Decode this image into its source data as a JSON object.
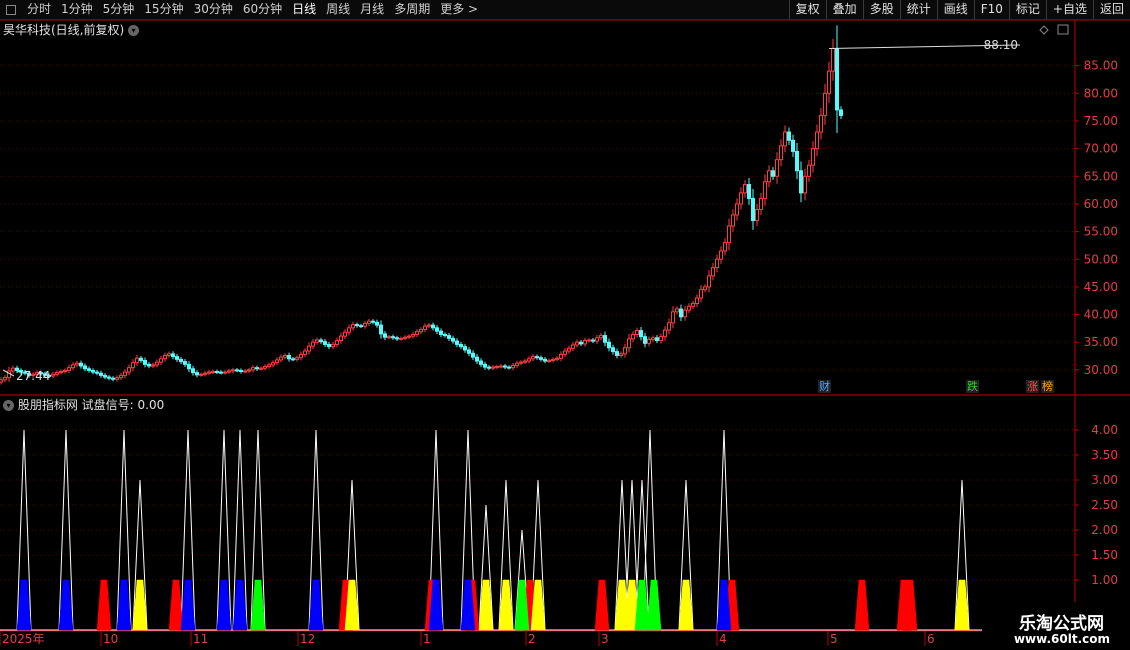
{
  "toolbar": {
    "tabs": [
      "分时",
      "1分钟",
      "5分钟",
      "15分钟",
      "30分钟",
      "60分钟",
      "日线",
      "周线",
      "月线",
      "多周期",
      "更多 >"
    ],
    "active_tab": "日线",
    "buttons": [
      "复权",
      "叠加",
      "多股",
      "统计",
      "画线",
      "F10",
      "标记",
      "+自选",
      "返回"
    ]
  },
  "stock": {
    "title": "昊华科技(日线,前复权)"
  },
  "price_panel": {
    "high_label": "88.10",
    "low_label": "27.44",
    "y_ticks": [
      "85.00",
      "80.00",
      "75.00",
      "70.00",
      "65.00",
      "60.00",
      "55.00",
      "50.00",
      "45.00",
      "40.00",
      "35.00",
      "30.00"
    ],
    "tags": [
      {
        "text": "财",
        "color": "#4ea2ff"
      },
      {
        "text": "跌",
        "color": "#33cc33"
      },
      {
        "text": "涨",
        "color": "#ff4d4d"
      },
      {
        "text": "榜",
        "color": "#ffaa00"
      }
    ]
  },
  "indicator": {
    "title": "股朋指标网 试盘信号: 0.00",
    "y_ticks": [
      "4.00",
      "3.50",
      "3.00",
      "2.50",
      "2.00",
      "1.50",
      "1.00"
    ]
  },
  "x_axis": {
    "labels": [
      "2025年",
      "10",
      "11",
      "12",
      "1",
      "2",
      "3",
      "4",
      "5",
      "6"
    ]
  },
  "colors": {
    "up": "#ff3c3c",
    "down": "#54fcfc",
    "grid": "#5a0000",
    "axis": "#c00000",
    "signal_red": "#ff0000",
    "signal_blue": "#0000ff",
    "signal_yellow": "#ffff00",
    "signal_green": "#00ff00",
    "spike": "#ffffff"
  },
  "chart_data": [
    {
      "type": "candlestick",
      "title": "",
      "ylim": [
        26,
        90
      ],
      "note_scale": "linear",
      "x": [
        1,
        5,
        9,
        13,
        17,
        21,
        25,
        29,
        33,
        37,
        41,
        45,
        49,
        53,
        57,
        61,
        65,
        69,
        73,
        77,
        81,
        85,
        89,
        93,
        97,
        101,
        105,
        109,
        113,
        117,
        121,
        125,
        129,
        133,
        137,
        141,
        145,
        149,
        153,
        157,
        161,
        165,
        169,
        173,
        177,
        181,
        185,
        189,
        193,
        197,
        201,
        205,
        209,
        213,
        217,
        221,
        225,
        229,
        233,
        237,
        241,
        245,
        249,
        253,
        257,
        261,
        265,
        269,
        273,
        277,
        281,
        285,
        289,
        293,
        297,
        301,
        305,
        309,
        313,
        317,
        321,
        325,
        329,
        333,
        337,
        341,
        345,
        349,
        353,
        357,
        361,
        365,
        369,
        373,
        377,
        381,
        385,
        389,
        393,
        397,
        401,
        405,
        409,
        413,
        417,
        421,
        425,
        429,
        433,
        437,
        441,
        445,
        449,
        453,
        457,
        461,
        465,
        469,
        473,
        477,
        481,
        485,
        489,
        493,
        497,
        501,
        505,
        509,
        513,
        517,
        521,
        525,
        529,
        533,
        537,
        541,
        545,
        549,
        553,
        557,
        561,
        565,
        569,
        573,
        577,
        581,
        585,
        589,
        593,
        597,
        601,
        605,
        609,
        613,
        617,
        621,
        625,
        629,
        633,
        637,
        641,
        645,
        649,
        653,
        657,
        661,
        665,
        669,
        673,
        677,
        681,
        685,
        689,
        693,
        697,
        701,
        705,
        709,
        713,
        717,
        721,
        725,
        729,
        733,
        737,
        741,
        745,
        749,
        753,
        757,
        761,
        765,
        769,
        773,
        777,
        781,
        785,
        789,
        793,
        797,
        801,
        805,
        809,
        813,
        817,
        821,
        825,
        829,
        833,
        837,
        841,
        845,
        849,
        853,
        857,
        861,
        865,
        869,
        873,
        877,
        881,
        885,
        889,
        893,
        897,
        901,
        905,
        909,
        913,
        917,
        921,
        925,
        929,
        933,
        937,
        941,
        945,
        949,
        953,
        957,
        961,
        965,
        969,
        973,
        977,
        981,
        985,
        989,
        993,
        997,
        1001,
        1005,
        1009,
        1013,
        1017,
        1021,
        1025,
        1029,
        1033,
        1037,
        1041,
        1045,
        1049
      ],
      "close": [
        28.2,
        28.6,
        29.8,
        30.3,
        29.9,
        29.6,
        29.4,
        29.0,
        29.2,
        29.5,
        29.3,
        29.0,
        28.9,
        29.2,
        29.5,
        29.7,
        29.9,
        30.4,
        30.9,
        31.2,
        30.7,
        30.2,
        29.9,
        29.6,
        29.4,
        29.0,
        28.7,
        28.5,
        28.3,
        28.6,
        29.0,
        29.6,
        30.4,
        31.3,
        32.1,
        31.7,
        31.0,
        30.7,
        30.9,
        31.4,
        32.0,
        32.6,
        32.9,
        32.4,
        31.9,
        31.5,
        31.0,
        30.2,
        29.5,
        29.1,
        29.2,
        29.4,
        29.6,
        29.7,
        29.6,
        29.5,
        29.6,
        29.8,
        30.0,
        29.9,
        29.7,
        29.8,
        30.0,
        30.4,
        30.2,
        30.3,
        30.6,
        30.9,
        31.3,
        31.8,
        32.3,
        32.6,
        32.0,
        31.9,
        32.2,
        32.8,
        33.4,
        34.3,
        35.0,
        35.4,
        35.1,
        34.6,
        34.2,
        34.6,
        35.3,
        36.1,
        36.8,
        37.6,
        38.2,
        38.0,
        37.9,
        38.4,
        38.8,
        38.6,
        38.1,
        36.5,
        35.9,
        36.0,
        35.8,
        35.6,
        35.7,
        35.9,
        36.1,
        36.4,
        36.9,
        37.3,
        37.9,
        38.1,
        37.6,
        37.0,
        36.4,
        36.2,
        35.7,
        35.2,
        34.6,
        34.2,
        33.6,
        33.0,
        32.3,
        31.6,
        31.0,
        30.5,
        30.3,
        30.5,
        30.6,
        30.7,
        30.5,
        30.4,
        30.8,
        31.2,
        31.4,
        31.6,
        32.0,
        32.4,
        32.2,
        31.9,
        31.6,
        31.7,
        31.9,
        32.1,
        32.8,
        33.4,
        33.9,
        34.5,
        35.0,
        34.7,
        35.3,
        35.4,
        35.2,
        35.8,
        36.2,
        35.0,
        34.0,
        33.3,
        32.6,
        32.9,
        34.0,
        35.6,
        36.4,
        37.1,
        36.0,
        34.8,
        35.5,
        35.8,
        35.3,
        36.0,
        37.2,
        38.5,
        40.5,
        41.0,
        39.6,
        40.8,
        41.5,
        42.0,
        43.0,
        44.5,
        45.0,
        47.0,
        48.5,
        50.0,
        51.5,
        53.0,
        56.0,
        58.0,
        60.0,
        62.0,
        63.5,
        61.0,
        57.0,
        59.0,
        61.0,
        64.0,
        66.0,
        65.0,
        68.0,
        70.5,
        73.0,
        71.5,
        69.5,
        66.0,
        62.0,
        65.0,
        67.0,
        70.0,
        73.0,
        76.0,
        80.0,
        84.0,
        88.1,
        77.0,
        76.0
      ]
    },
    {
      "type": "bar",
      "title": "",
      "ylim": [
        0,
        4.4
      ],
      "series": [
        {
          "color": "#ffffff",
          "points": [
            [
              24,
              4
            ],
            [
              66,
              4
            ],
            [
              124,
              4
            ],
            [
              140,
              3
            ],
            [
              188,
              4
            ],
            [
              224,
              4
            ],
            [
              240,
              4
            ],
            [
              258,
              4
            ],
            [
              316,
              4
            ],
            [
              352,
              3
            ],
            [
              436,
              4
            ],
            [
              468,
              4
            ],
            [
              486,
              2.5
            ],
            [
              506,
              3
            ],
            [
              522,
              2
            ],
            [
              538,
              3
            ],
            [
              622,
              3
            ],
            [
              632,
              3
            ],
            [
              642,
              3
            ],
            [
              650,
              4
            ],
            [
              686,
              3
            ],
            [
              724,
              4
            ],
            [
              962,
              3
            ]
          ]
        },
        {
          "color": "#ff0000",
          "points": [
            [
              104,
              1
            ],
            [
              176,
              1
            ],
            [
              346,
              1
            ],
            [
              432,
              1
            ],
            [
              472,
              1
            ],
            [
              530,
              1
            ],
            [
              602,
              1
            ],
            [
              732,
              1
            ],
            [
              862,
              1
            ],
            [
              904,
              1
            ],
            [
              910,
              1
            ]
          ]
        },
        {
          "color": "#0000ff",
          "points": [
            [
              24,
              1
            ],
            [
              66,
              1
            ],
            [
              124,
              1
            ],
            [
              188,
              1
            ],
            [
              224,
              1
            ],
            [
              240,
              1
            ],
            [
              316,
              1
            ],
            [
              436,
              1
            ],
            [
              468,
              1
            ],
            [
              724,
              1
            ]
          ]
        },
        {
          "color": "#ffff00",
          "points": [
            [
              140,
              1
            ],
            [
              352,
              1
            ],
            [
              486,
              1
            ],
            [
              506,
              1
            ],
            [
              538,
              1
            ],
            [
              622,
              1
            ],
            [
              632,
              1
            ],
            [
              686,
              1
            ],
            [
              962,
              1
            ]
          ]
        },
        {
          "color": "#00ff00",
          "points": [
            [
              258,
              1
            ],
            [
              522,
              1
            ],
            [
              642,
              1
            ],
            [
              654,
              1
            ]
          ]
        }
      ]
    }
  ],
  "watermark": {
    "title": "乐淘公式网",
    "url": "www.60lt.com"
  }
}
